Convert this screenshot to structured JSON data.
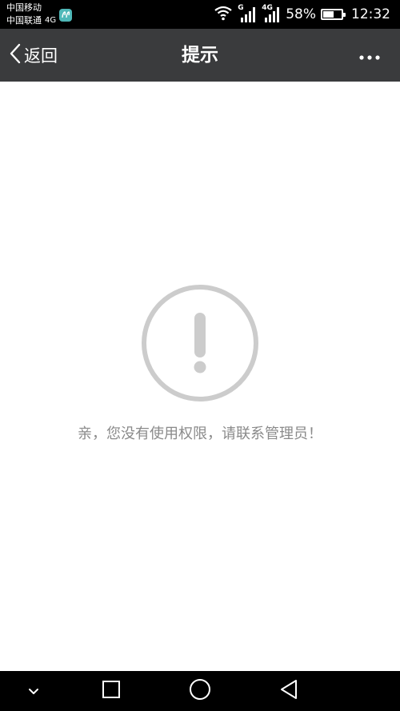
{
  "status_bar": {
    "carrier_1": "中国移动",
    "carrier_2": "中国联通",
    "carrier_2_network": "4G",
    "signal_1_tag": "G",
    "signal_2_tag": "4G",
    "battery_percent": "58%",
    "battery_level": 0.58,
    "time": "12:32",
    "icons": [
      "app-notification-icon",
      "wifi-icon",
      "signal-icon",
      "signal-icon",
      "battery-icon"
    ]
  },
  "nav_bar": {
    "back_label": "返回",
    "title": "提示",
    "more_icon": "more-dots-icon",
    "background": "#3a3b3d"
  },
  "content": {
    "icon": "exclamation-circle-icon",
    "message": "亲，您没有使用权限，请联系管理员！",
    "icon_color": "#cccccc",
    "message_color": "#8a8a8a"
  },
  "android_nav": {
    "icons": [
      "collapse-chevron-icon",
      "recent-apps-square-icon",
      "home-circle-icon",
      "back-triangle-icon"
    ]
  }
}
